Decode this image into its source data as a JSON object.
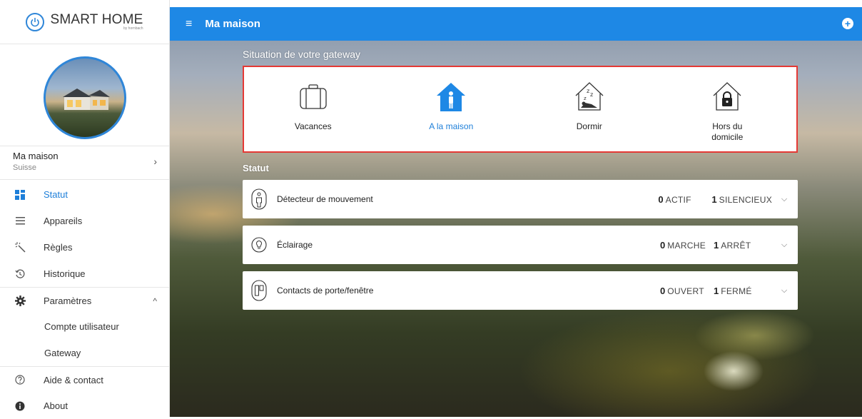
{
  "brand": {
    "name": "SMART HOME",
    "sub": "by hornbach"
  },
  "sidebar": {
    "home": {
      "name": "Ma maison",
      "country": "Suisse"
    },
    "items": [
      {
        "label": "Statut",
        "icon": "dashboard-icon"
      },
      {
        "label": "Appareils",
        "icon": "list-icon"
      },
      {
        "label": "Règles",
        "icon": "magic-wand-icon"
      },
      {
        "label": "Historique",
        "icon": "history-icon"
      },
      {
        "label": "Paramètres",
        "icon": "gear-icon"
      },
      {
        "label": "Compte utilisateur"
      },
      {
        "label": "Gateway"
      },
      {
        "label": "Aide & contact",
        "icon": "help-icon"
      },
      {
        "label": "About",
        "icon": "info-icon"
      }
    ]
  },
  "topbar": {
    "title": "Ma maison"
  },
  "gateway": {
    "title": "Situation de votre gateway",
    "modes": [
      {
        "label": "Vacances",
        "icon": "luggage-icon"
      },
      {
        "label": "A la maison",
        "icon": "home-person-icon",
        "active": true
      },
      {
        "label": "Dormir",
        "icon": "sleep-icon"
      },
      {
        "label": "Hors du domicile",
        "icon": "home-lock-icon"
      }
    ]
  },
  "status": {
    "title": "Statut",
    "rows": [
      {
        "label": "Détecteur de mouvement",
        "a_count": "0",
        "a_label": "ACTIF",
        "b_count": "1",
        "b_label": "SILENCIEUX",
        "icon": "motion-sensor-icon"
      },
      {
        "label": "Éclairage",
        "a_count": "0",
        "a_label": "MARCHE",
        "b_count": "1",
        "b_label": "ARRÊT",
        "icon": "bulb-icon"
      },
      {
        "label": "Contacts de porte/fenêtre",
        "a_count": "0",
        "a_label": "OUVERT",
        "b_count": "1",
        "b_label": "FERMÉ",
        "icon": "door-contact-icon"
      }
    ]
  },
  "colors": {
    "accent": "#1e88e5",
    "highlight": "#e53935"
  }
}
